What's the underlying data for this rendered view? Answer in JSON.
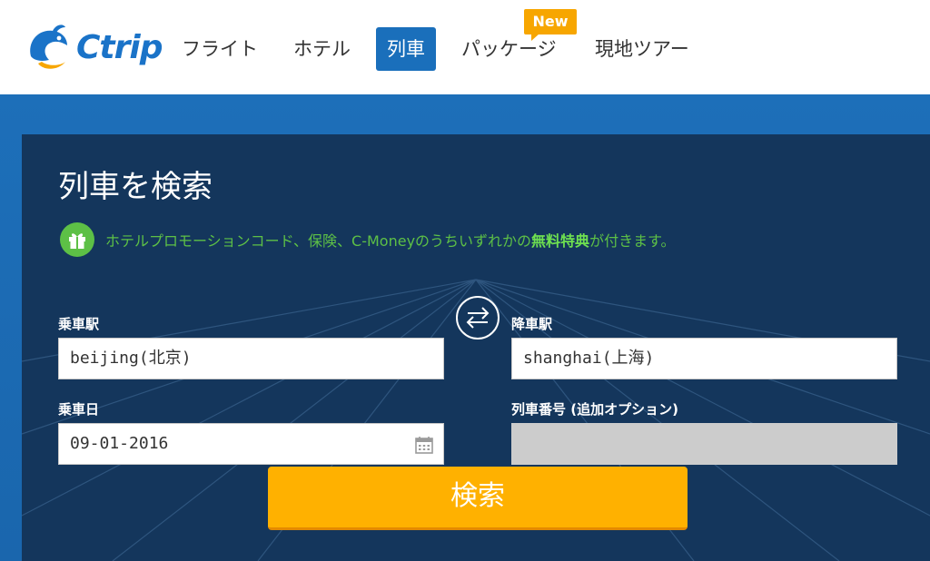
{
  "brand": {
    "name": "Ctrip",
    "logo_color": "#1a73c8",
    "accent_color": "#1a6fbb"
  },
  "nav": {
    "items": [
      {
        "label": "フライト",
        "active": false
      },
      {
        "label": "ホテル",
        "active": false
      },
      {
        "label": "列車",
        "active": true
      },
      {
        "label": "パッケージ",
        "active": false
      },
      {
        "label": "現地ツアー",
        "active": false
      }
    ],
    "new_badge": "New"
  },
  "search": {
    "title": "列車を検索",
    "promo_prefix": "ホテルプロモーションコード、保険、C-Moneyのうちいずれかの",
    "promo_highlight": "無料特典",
    "promo_suffix": "が付きます。",
    "from_label": "乗車駅",
    "from_value": "beijing(北京)",
    "to_label": "降車駅",
    "to_value": "shanghai(上海)",
    "date_label": "乗車日",
    "date_value": "09-01-2016",
    "train_no_label": "列車番号 (追加オプション)",
    "train_no_value": "",
    "submit_label": "検索"
  },
  "icons": {
    "gift": "gift-icon",
    "swap": "swap-icon",
    "calendar": "calendar-icon"
  },
  "colors": {
    "promo_green": "#5dc046",
    "button_orange": "#ffb100",
    "panel_bg": "#14365c",
    "hero_bg": "#1d6fb9"
  }
}
